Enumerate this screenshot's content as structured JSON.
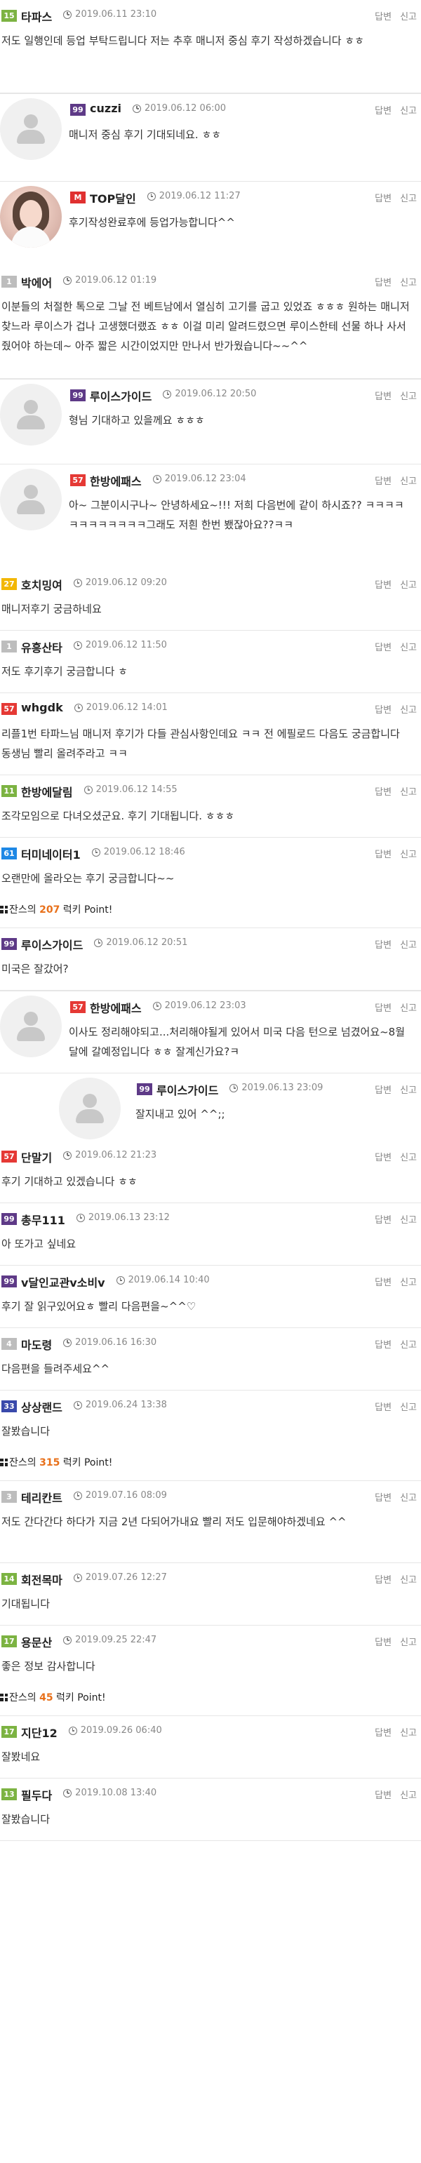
{
  "actions": {
    "reply": "답변",
    "report": "신고"
  },
  "bonus_labels": {
    "prefix": "잔스의",
    "suffix": "럭키 Point!"
  },
  "comments": [
    {
      "level": "15",
      "level_color": "#7cb342",
      "user": "타파스",
      "time": "2019.06.11 23:10",
      "text": "저도 일행인데 등업 부탁드립니다 저는 추후 매니저 중심 후기 작성하겠습니다 ㅎㅎ"
    },
    {
      "level": "99",
      "level_color": "#5e3a87",
      "user": "cuzzi",
      "time": "2019.06.12 06:00",
      "text": "매니저 중심 후기 기대되네요. ㅎㅎ"
    },
    {
      "level": "M",
      "level_color": "#e03030",
      "user": "TOP달인",
      "time": "2019.06.12 11:27",
      "text": "후기작성완료후에 등업가능합니다^^"
    },
    {
      "level": "1",
      "level_color": "#bdbdbd",
      "user": "박에어",
      "time": "2019.06.12 01:19",
      "text": "이분들의 처절한 톡으로 그날 전 베트남에서 열심히 고기를 굽고 있었죠 ㅎㅎㅎ 원하는 매니저 찾느라 루이스가 겁나 고생했더랬죠 ㅎㅎ 이걸 미리 알려드렸으면 루이스한테 선물 하나 사서 줬어야 하는데~ 아주 짧은 시간이었지만 만나서 반가웠습니다~~^^"
    },
    {
      "level": "99",
      "level_color": "#5e3a87",
      "user": "루이스가이드",
      "time": "2019.06.12 20:50",
      "text": "형님 기대하고 있을께요 ㅎㅎㅎ"
    },
    {
      "level": "57",
      "level_color": "#e53935",
      "user": "한방에패스",
      "time": "2019.06.12 23:04",
      "text": "아~ 그분이시구나~ 안녕하세요~!!! 저희 다음번에 같이 하시죠?? ㅋㅋㅋㅋㅋㅋㅋㅋㅋㅋㅋㅋ그래도 저흰 한번 뵀잖아요??ㅋㅋ"
    },
    {
      "level": "27",
      "level_color": "#f2b705",
      "user": "호치밍여",
      "time": "2019.06.12 09:20",
      "text": "매니저후기  궁금하네요"
    },
    {
      "level": "1",
      "level_color": "#bdbdbd",
      "user": "유흥산타",
      "time": "2019.06.12 11:50",
      "text": "저도 후기후기 궁금합니다 ㅎ"
    },
    {
      "level": "57",
      "level_color": "#e53935",
      "user": "whgdk",
      "time": "2019.06.12 14:01",
      "text": "리플1번 타파느님 매니저 후기가 다들 관심사항인데요 ㅋㅋ 전 에필로드 다음도 궁금합니다 동생님 빨리 올려주라고 ㅋㅋ"
    },
    {
      "level": "11",
      "level_color": "#7cb342",
      "user": "한방에달림",
      "time": "2019.06.12 14:55",
      "text": "조각모임으로 다녀오셨군요. 후기 기대됩니다. ㅎㅎㅎ"
    },
    {
      "level": "61",
      "level_color": "#1e88e5",
      "user": "터미네이터1",
      "time": "2019.06.12 18:46",
      "text": "오랜만에 올라오는 후기 궁금합니다~~",
      "points": "207"
    },
    {
      "level": "99",
      "level_color": "#5e3a87",
      "user": "루이스가이드",
      "time": "2019.06.12 20:51",
      "text": "미국은 잘갔어?"
    },
    {
      "level": "57",
      "level_color": "#e53935",
      "user": "한방에패스",
      "time": "2019.06.12 23:03",
      "text": "이사도 정리해야되고...처리해야될게 있어서 미국 다음 턴으로 넘겼어요~8월달에 갈예정입니다 ㅎㅎ 잘계신가요?ㅋ"
    },
    {
      "level": "99",
      "level_color": "#5e3a87",
      "user": "루이스가이드",
      "time": "2019.06.13 23:09",
      "text": "잘지내고 있어 ^^;;"
    },
    {
      "level": "57",
      "level_color": "#e53935",
      "user": "단말기",
      "time": "2019.06.12 21:23",
      "text": "후기 기대하고 있겠습니다 ㅎㅎ"
    },
    {
      "level": "99",
      "level_color": "#5e3a87",
      "user": "총무111",
      "time": "2019.06.13 23:12",
      "text": "아 또가고 싶네요"
    },
    {
      "level": "99",
      "level_color": "#5e3a87",
      "user": "v달인교관v소비v",
      "time": "2019.06.14 10:40",
      "text": "후기 잘 읽구있어요ㅎ 빨리 다음편을~^^♡"
    },
    {
      "level": "4",
      "level_color": "#bdbdbd",
      "user": "마도령",
      "time": "2019.06.16 16:30",
      "text": "다음편을 들려주세요^^"
    },
    {
      "level": "33",
      "level_color": "#3949ab",
      "user": "상상랜드",
      "time": "2019.06.24 13:38",
      "text": "잘봤습니다",
      "points": "315"
    },
    {
      "level": "3",
      "level_color": "#bdbdbd",
      "user": "테리칸트",
      "time": "2019.07.16 08:09",
      "text": "저도 간다간다 하다가 지금 2년 다되어가내요 빨리 저도 입문해야하겠네요 ^^"
    },
    {
      "level": "14",
      "level_color": "#7cb342",
      "user": "회전목마",
      "time": "2019.07.26 12:27",
      "text": "기대됩니다"
    },
    {
      "level": "17",
      "level_color": "#7cb342",
      "user": "용문산",
      "time": "2019.09.25 22:47",
      "text": "좋은 정보 감사합니다",
      "points": "45"
    },
    {
      "level": "17",
      "level_color": "#7cb342",
      "user": "지단12",
      "time": "2019.09.26 06:40",
      "text": "잘봤네요"
    },
    {
      "level": "13",
      "level_color": "#7cb342",
      "user": "필두다",
      "time": "2019.10.08 13:40",
      "text": "잘봤습니다"
    }
  ]
}
